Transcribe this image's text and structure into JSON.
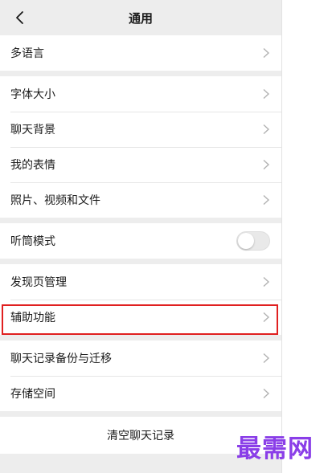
{
  "header": {
    "title": "通用",
    "back_icon": "back-chevron-icon"
  },
  "groups": [
    [
      {
        "label": "多语言"
      }
    ],
    [
      {
        "label": "字体大小"
      },
      {
        "label": "聊天背景"
      },
      {
        "label": "我的表情"
      },
      {
        "label": "照片、视频和文件"
      }
    ],
    [
      {
        "label": "听筒模式",
        "toggle": "off"
      }
    ],
    [
      {
        "label": "发现页管理"
      },
      {
        "label": "辅助功能"
      }
    ],
    [
      {
        "label": "聊天记录备份与迁移"
      },
      {
        "label": "存储空间"
      }
    ]
  ],
  "clear_button": {
    "label": "清空聊天记录"
  },
  "watermark": {
    "text": "最需网",
    "color": "#8a3ee8"
  },
  "colors": {
    "highlight_border": "#e02020",
    "background": "#ededed",
    "toggle_off": "#e9e9e9"
  }
}
